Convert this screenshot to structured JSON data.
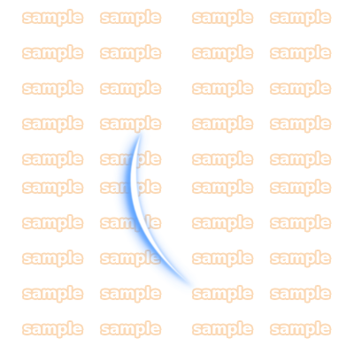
{
  "watermark": {
    "text": "sample",
    "color": "#fbd9b6",
    "rows": 10,
    "columns": 4
  },
  "effect": {
    "name": "crescent-slash",
    "core_color": "#ffffff",
    "glow_color": "#3d8bff"
  }
}
